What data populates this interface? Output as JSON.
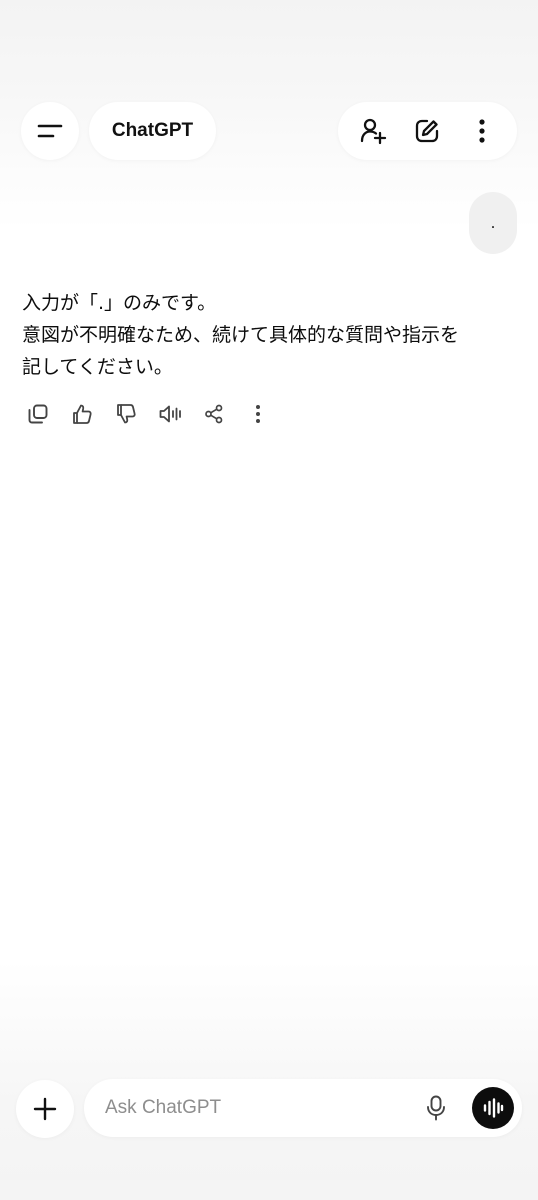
{
  "header": {
    "title": "ChatGPT",
    "menu_icon": "menu-icon",
    "actions": [
      "add-person-icon",
      "edit-icon",
      "more-vertical-icon"
    ]
  },
  "conversation": {
    "user_message": ".",
    "assistant_lines": [
      "入力が「.」のみです。",
      "意図が不明確なため、続けて具体的な質問や指示を",
      "記してください。"
    ],
    "message_actions": [
      "copy-icon",
      "thumbs-up-icon",
      "thumbs-down-icon",
      "speaker-icon",
      "share-icon",
      "more-vertical-icon"
    ]
  },
  "composer": {
    "placeholder": "Ask ChatGPT",
    "value": "",
    "icons": [
      "plus-icon",
      "mic-icon",
      "voice-wave-icon"
    ]
  },
  "colors": {
    "background": "#ffffff",
    "bubble": "#f0f0f0",
    "text": "#0d0d0d",
    "placeholder": "#8e8e8e",
    "voice_button": "#0d0d0d"
  }
}
